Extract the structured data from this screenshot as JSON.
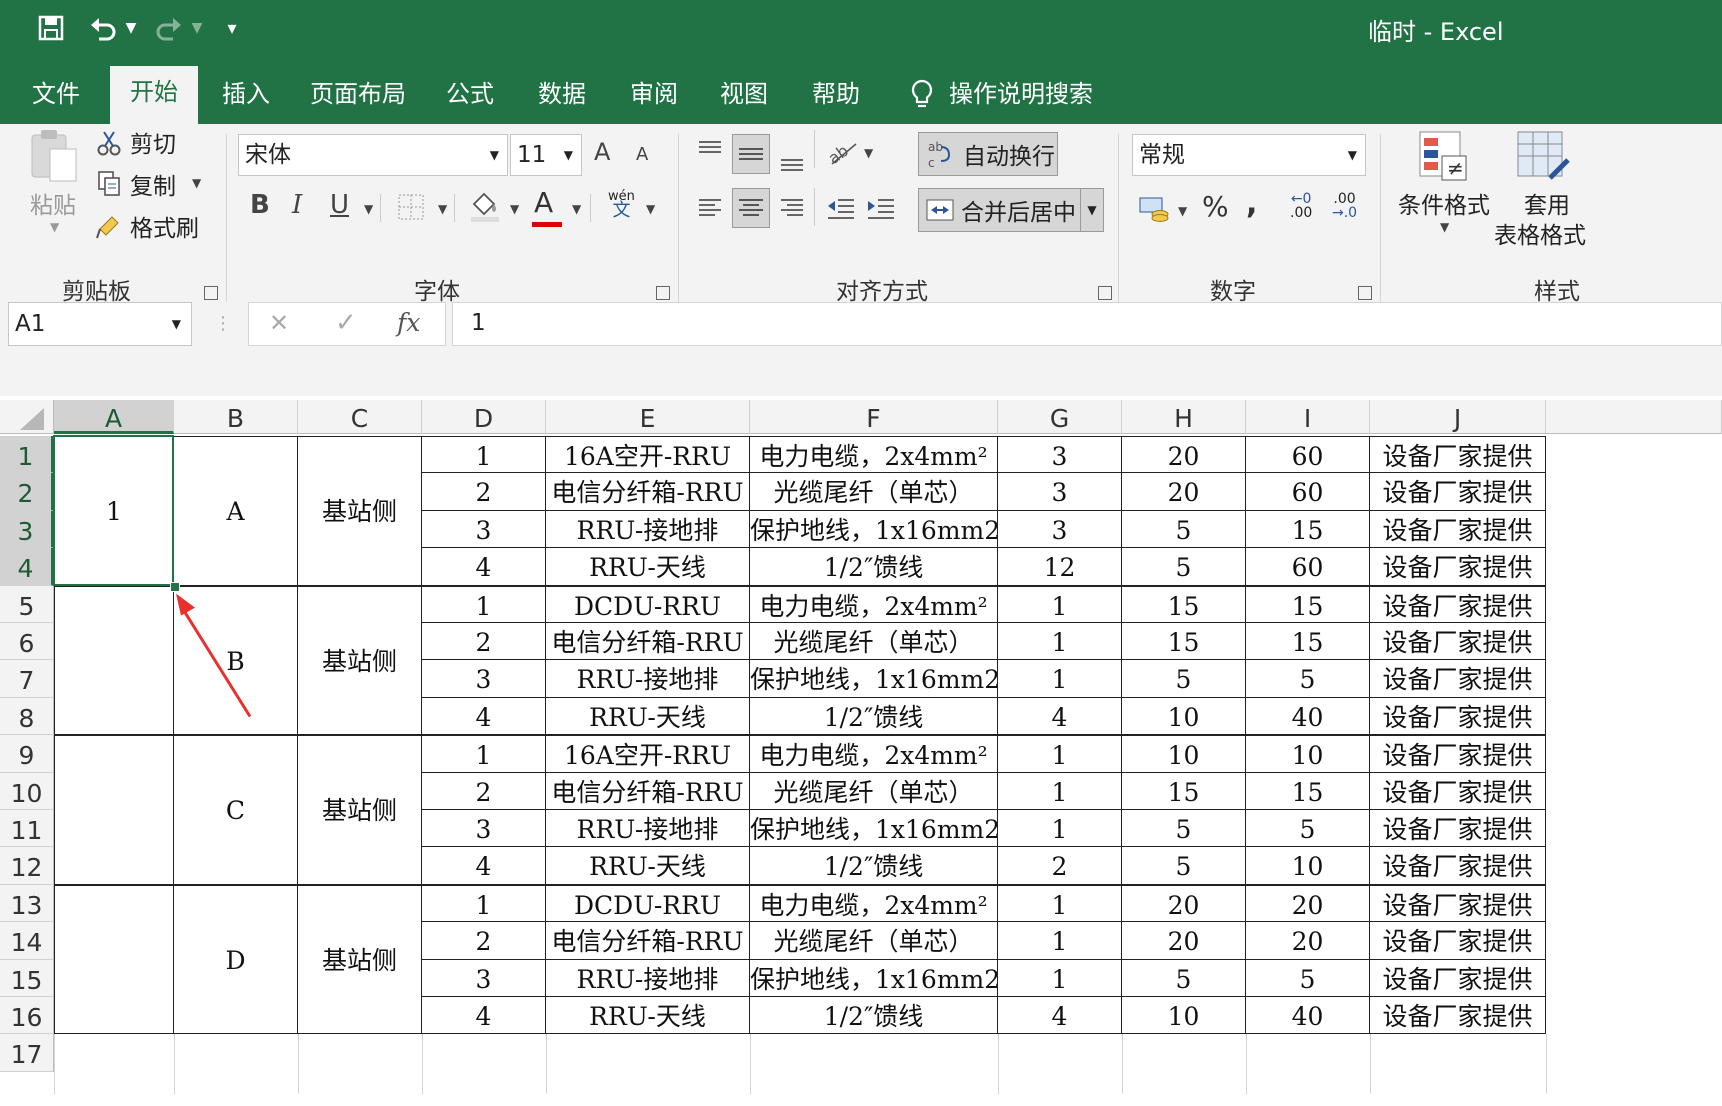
{
  "titlebar": {
    "title": "临时  -  Excel",
    "customize_glyph": "▾"
  },
  "tabs": [
    {
      "label": "文件",
      "active": false
    },
    {
      "label": "开始",
      "active": true
    },
    {
      "label": "插入",
      "active": false
    },
    {
      "label": "页面布局",
      "active": false
    },
    {
      "label": "公式",
      "active": false
    },
    {
      "label": "数据",
      "active": false
    },
    {
      "label": "审阅",
      "active": false
    },
    {
      "label": "视图",
      "active": false
    },
    {
      "label": "帮助",
      "active": false
    },
    {
      "label": "操作说明搜索",
      "active": false,
      "icon": "lightbulb-icon"
    }
  ],
  "clipboard": {
    "paste": "粘贴",
    "cut": "剪切",
    "copy": "复制",
    "format_painter": "格式刷",
    "group": "剪贴板"
  },
  "font": {
    "name": "宋体",
    "size": "11",
    "bold": "B",
    "italic": "I",
    "underline": "U",
    "font_color": "A",
    "phonetic_top": "wén",
    "phonetic_bottom": "文",
    "grow": "A",
    "shrink": "A",
    "group": "字体",
    "font_color_hex": "#e00000"
  },
  "alignment": {
    "wrap_text": "自动换行",
    "merge_center": "合并后居中",
    "group": "对齐方式"
  },
  "number": {
    "format": "常规",
    "percent": "%",
    "comma": ",",
    "inc_decimal_top": "←0",
    "inc_decimal_bottom": ".00",
    "dec_decimal_top": ".00",
    "dec_decimal_bottom": "→.0",
    "group": "数字"
  },
  "styles": {
    "conditional": "条件格式",
    "table_format_1": "套用",
    "table_format_2": "表格格式",
    "group": "样式"
  },
  "formula_bar": {
    "name_box": "A1",
    "cancel": "✕",
    "enter": "✓",
    "fx": "fx",
    "value": "1"
  },
  "columns": [
    "A",
    "B",
    "C",
    "D",
    "E",
    "F",
    "G",
    "H",
    "I",
    "J"
  ],
  "rows": [
    "1",
    "2",
    "3",
    "4",
    "5",
    "6",
    "7",
    "8",
    "9",
    "10",
    "11",
    "12",
    "13",
    "14",
    "15",
    "16",
    "17"
  ],
  "groups": [
    {
      "a": "1",
      "b": "A",
      "c": "基站侧"
    },
    {
      "a": "",
      "b": "B",
      "c": "基站侧"
    },
    {
      "a": "",
      "b": "C",
      "c": "基站侧"
    },
    {
      "a": "",
      "b": "D",
      "c": "基站侧"
    }
  ],
  "table": [
    [
      "1",
      "16A空开-RRU",
      "电力电缆，2x4mm²",
      "3",
      "20",
      "60",
      "设备厂家提供"
    ],
    [
      "2",
      "电信分纤箱-RRU",
      "光缆尾纤（单芯）",
      "3",
      "20",
      "60",
      "设备厂家提供"
    ],
    [
      "3",
      "RRU-接地排",
      "保护地线，1x16mm2",
      "3",
      "5",
      "15",
      "设备厂家提供"
    ],
    [
      "4",
      "RRU-天线",
      "1/2″馈线",
      "12",
      "5",
      "60",
      "设备厂家提供"
    ],
    [
      "1",
      "DCDU-RRU",
      "电力电缆，2x4mm²",
      "1",
      "15",
      "15",
      "设备厂家提供"
    ],
    [
      "2",
      "电信分纤箱-RRU",
      "光缆尾纤（单芯）",
      "1",
      "15",
      "15",
      "设备厂家提供"
    ],
    [
      "3",
      "RRU-接地排",
      "保护地线，1x16mm2",
      "1",
      "5",
      "5",
      "设备厂家提供"
    ],
    [
      "4",
      "RRU-天线",
      "1/2″馈线",
      "4",
      "10",
      "40",
      "设备厂家提供"
    ],
    [
      "1",
      "16A空开-RRU",
      "电力电缆，2x4mm²",
      "1",
      "10",
      "10",
      "设备厂家提供"
    ],
    [
      "2",
      "电信分纤箱-RRU",
      "光缆尾纤（单芯）",
      "1",
      "15",
      "15",
      "设备厂家提供"
    ],
    [
      "3",
      "RRU-接地排",
      "保护地线，1x16mm2",
      "1",
      "5",
      "5",
      "设备厂家提供"
    ],
    [
      "4",
      "RRU-天线",
      "1/2″馈线",
      "2",
      "5",
      "10",
      "设备厂家提供"
    ],
    [
      "1",
      "DCDU-RRU",
      "电力电缆，2x4mm²",
      "1",
      "20",
      "20",
      "设备厂家提供"
    ],
    [
      "2",
      "电信分纤箱-RRU",
      "光缆尾纤（单芯）",
      "1",
      "20",
      "20",
      "设备厂家提供"
    ],
    [
      "3",
      "RRU-接地排",
      "保护地线，1x16mm2",
      "1",
      "5",
      "5",
      "设备厂家提供"
    ],
    [
      "4",
      "RRU-天线",
      "1/2″馈线",
      "4",
      "10",
      "40",
      "设备厂家提供"
    ]
  ],
  "colors": {
    "accent": "#217346",
    "selection": "#217346",
    "arrow": "#e8312f"
  }
}
